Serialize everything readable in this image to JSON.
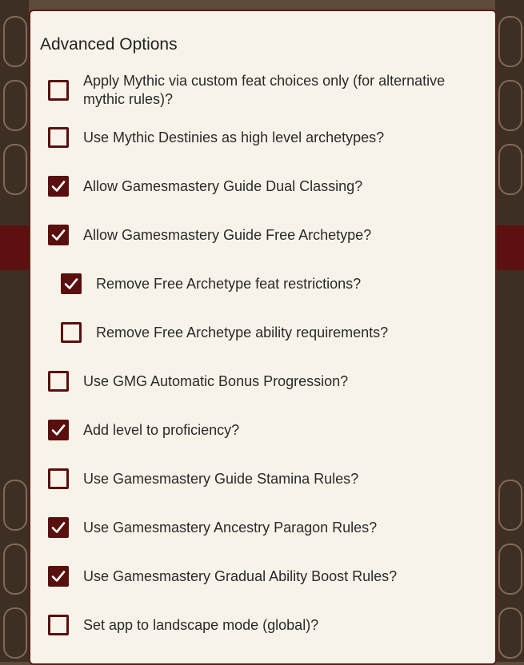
{
  "dialog": {
    "title": "Advanced Options",
    "options": [
      {
        "label": "Apply Mythic via custom feat choices only (for alternative mythic rules)?",
        "checked": false,
        "nested": false
      },
      {
        "label": "Use Mythic Destinies as high level archetypes?",
        "checked": false,
        "nested": false
      },
      {
        "label": "Allow Gamesmastery Guide Dual Classing?",
        "checked": true,
        "nested": false
      },
      {
        "label": "Allow Gamesmastery Guide Free Archetype?",
        "checked": true,
        "nested": false
      },
      {
        "label": "Remove Free Archetype feat restrictions?",
        "checked": true,
        "nested": true
      },
      {
        "label": "Remove Free Archetype ability requirements?",
        "checked": false,
        "nested": true
      },
      {
        "label": "Use GMG Automatic Bonus Progression?",
        "checked": false,
        "nested": false
      },
      {
        "label": "Add level to proficiency?",
        "checked": true,
        "nested": false
      },
      {
        "label": "Use Gamesmastery Guide Stamina Rules?",
        "checked": false,
        "nested": false
      },
      {
        "label": "Use Gamesmastery Ancestry Paragon Rules?",
        "checked": true,
        "nested": false
      },
      {
        "label": "Use Gamesmastery Gradual Ability Boost Rules?",
        "checked": true,
        "nested": false
      },
      {
        "label": "Set app to landscape mode (global)?",
        "checked": false,
        "nested": false
      }
    ]
  },
  "colors": {
    "accent": "#5a0f0f",
    "panel": "#f8f3e8"
  }
}
